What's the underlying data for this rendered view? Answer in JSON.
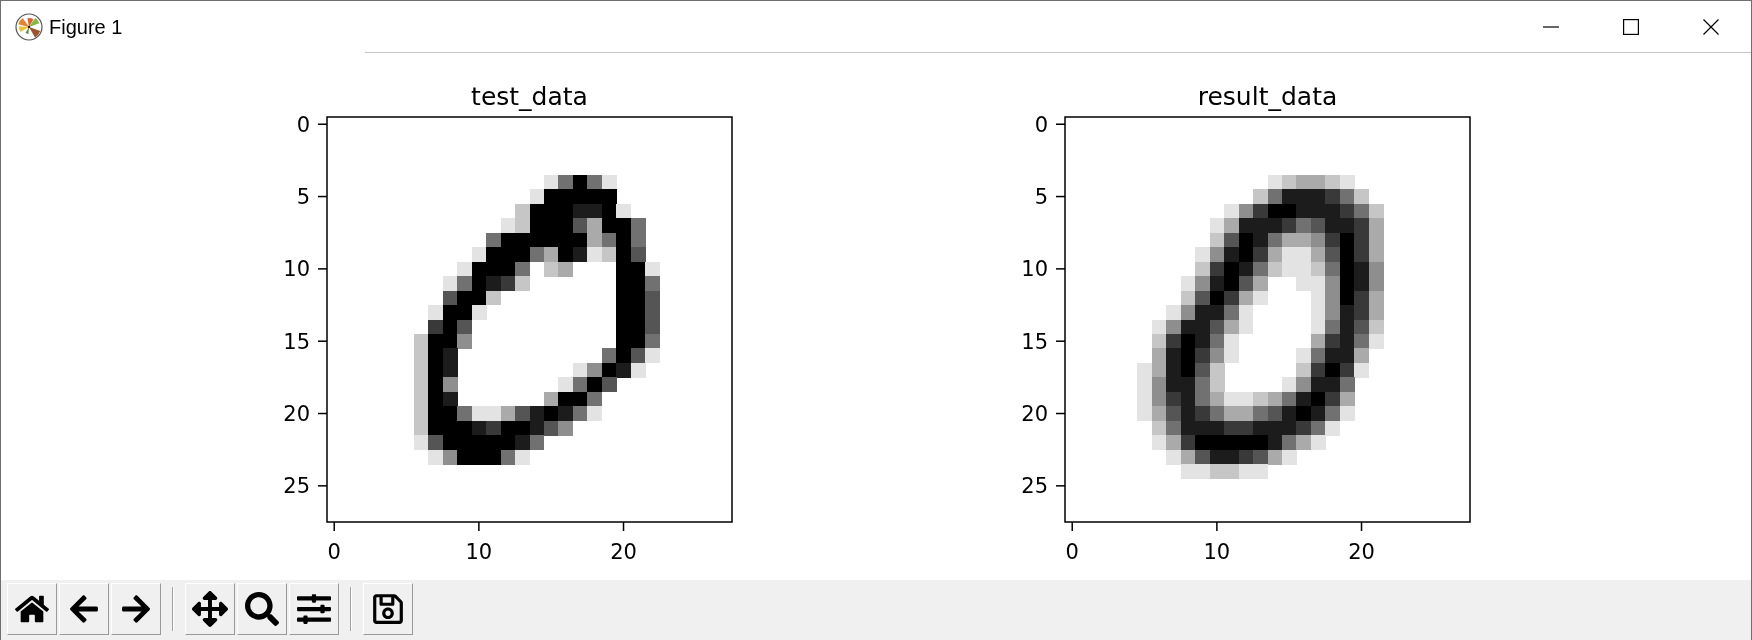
{
  "window": {
    "title": "Figure 1"
  },
  "figure": {
    "subplots": [
      {
        "title": "test_data",
        "y_tick_labels": [
          "0",
          "5",
          "10",
          "15",
          "20",
          "25"
        ],
        "x_tick_labels": [
          "0",
          "10",
          "20"
        ]
      },
      {
        "title": "result_data",
        "y_tick_labels": [
          "0",
          "5",
          "10",
          "15",
          "20",
          "25"
        ],
        "x_tick_labels": [
          "0",
          "10",
          "20"
        ]
      }
    ]
  }
}
